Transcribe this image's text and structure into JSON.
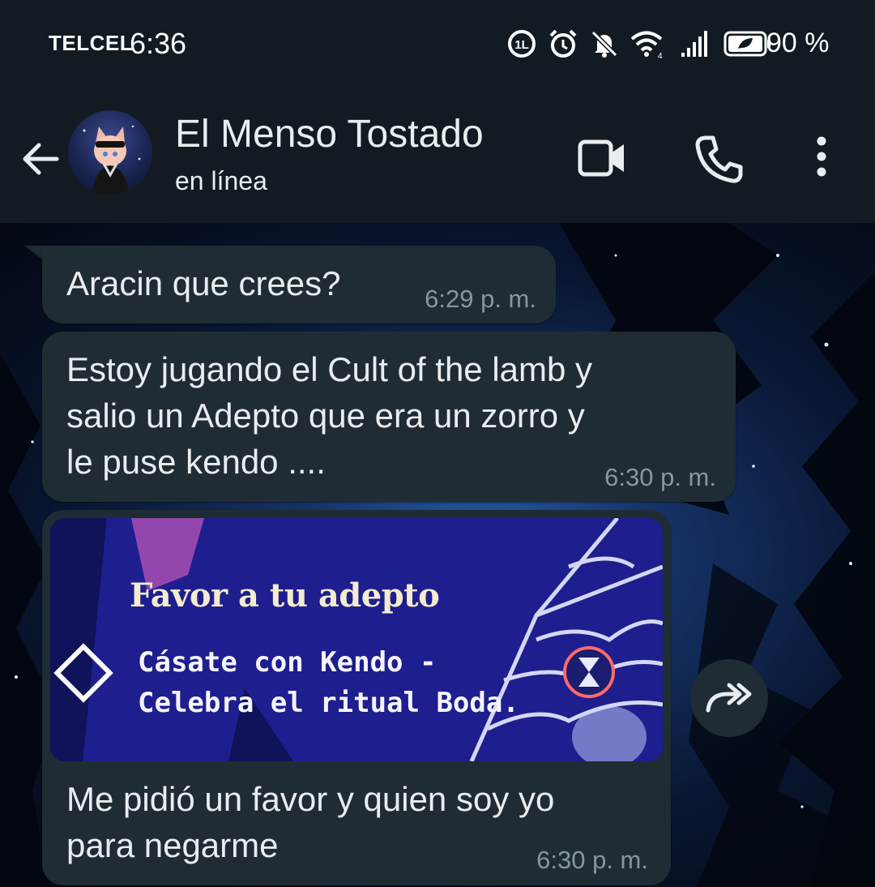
{
  "status_bar": {
    "carrier": "TELCEL",
    "time": "6:36",
    "battery": "90 %",
    "icons": [
      "data-saver-icon",
      "alarm-icon",
      "mute-icon",
      "wifi-icon",
      "signal-icon",
      "battery-icon"
    ]
  },
  "header": {
    "contact_name": "El Menso Tostado",
    "status": "en línea",
    "actions": [
      "back-arrow-icon",
      "video-call-icon",
      "phone-icon",
      "more-vert-icon"
    ]
  },
  "messages": [
    {
      "text": "Aracin que crees?",
      "time": "6:29 p. m."
    },
    {
      "text": "Estoy jugando el Cult of the lamb y\nsalio un Adepto que era un zorro y\nle puse kendo ....",
      "time": "6:30 p. m."
    },
    {
      "image": {
        "title": "Favor a tu adepto",
        "line1": "Cásate con Kendo -",
        "line2": "Celebra el ritual Boda."
      },
      "text": "Me pidió un favor y quien soy yo\npara negarme",
      "time": "6:30 p. m."
    }
  ],
  "colors": {
    "header_bg": "#111b21",
    "bubble_bg": "#1f2c33",
    "text": "#e9edef",
    "meta_text": "#8696a0"
  }
}
